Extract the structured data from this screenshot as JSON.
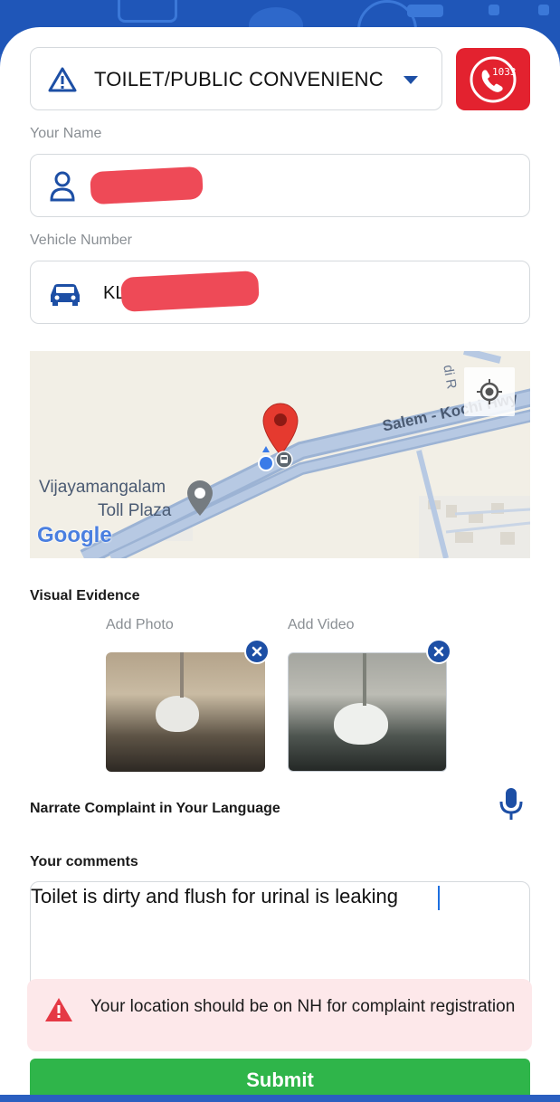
{
  "category": {
    "selected": "TOILET/PUBLIC CONVENIENC"
  },
  "helpline": {
    "number": "1033"
  },
  "name_field": {
    "label": "Your Name"
  },
  "vehicle_field": {
    "label": "Vehicle Number",
    "value": "KL"
  },
  "map": {
    "road_label": "Salem - Kochi Hwy",
    "road_label_fragment": "di R",
    "place_label_line1": "Vijayamangalam",
    "place_label_line2": "Toll Plaza",
    "google_logo": "Google"
  },
  "visual_evidence": {
    "title": "Visual Evidence",
    "photo_label": "Add Photo",
    "video_label": "Add Video"
  },
  "narrate": {
    "title": "Narrate Complaint in Your Language"
  },
  "comments": {
    "title": "Your comments",
    "value": "Toilet is dirty and flush for urinal is leaking"
  },
  "alert": {
    "message": "Your location should be on NH for complaint registration"
  },
  "submit": {
    "label": "Submit"
  },
  "colors": {
    "brand_blue": "#1d4fa5",
    "alert_red": "#e53945",
    "submit_green": "#2fb54a",
    "helpline_red": "#e3222f"
  }
}
